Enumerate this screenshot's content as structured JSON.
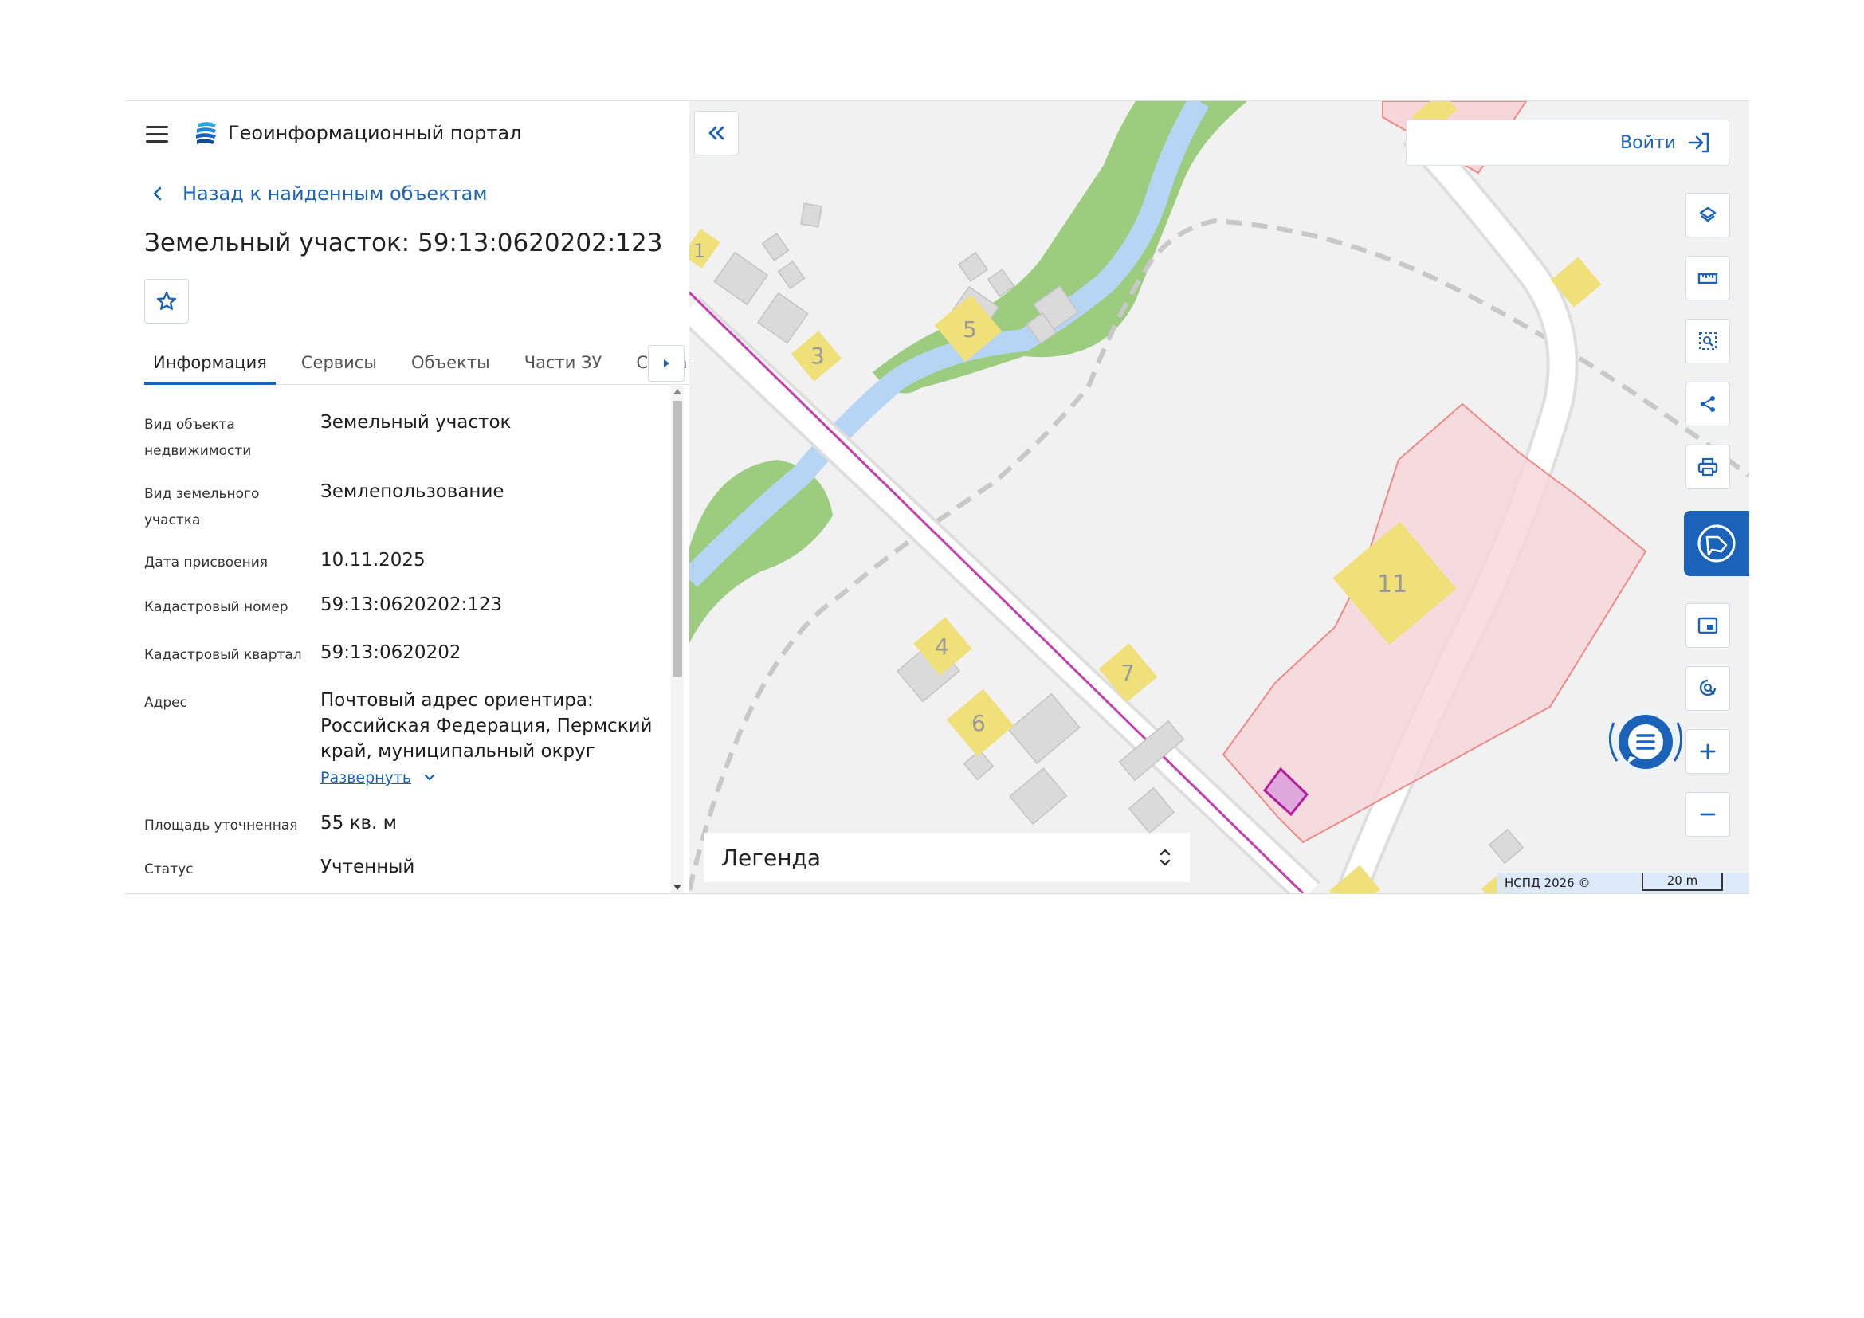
{
  "header": {
    "brand": "Геоинформационный портал"
  },
  "navigation": {
    "back_label": "Назад к найденным объектам"
  },
  "object": {
    "title": "Земельный участок: 59:13:0620202:123"
  },
  "tabs": [
    {
      "label": "Информация",
      "active": true
    },
    {
      "label": "Сервисы",
      "active": false
    },
    {
      "label": "Объекты",
      "active": false
    },
    {
      "label": "Части ЗУ",
      "active": false
    },
    {
      "label": "Состав",
      "active": false
    }
  ],
  "properties": {
    "object_type": {
      "label": "Вид объекта недвижимости",
      "value": "Земельный участок"
    },
    "land_type": {
      "label": "Вид земельного участка",
      "value": "Землепользование"
    },
    "assign_date": {
      "label": "Дата присвоения",
      "value": "10.11.2025"
    },
    "cadastral_number": {
      "label": "Кадастровый номер",
      "value": "59:13:0620202:123"
    },
    "cadastral_quarter": {
      "label": "Кадастровый квартал",
      "value": "59:13:0620202"
    },
    "address": {
      "label": "Адрес",
      "value": "Почтовый адрес ориентира: Российская Федерация, Пермский край, муниципальный округ",
      "expand_label": "Развернуть"
    },
    "area": {
      "label": "Площадь уточненная",
      "value": "55 кв. м"
    },
    "status": {
      "label": "Статус",
      "value": "Учтенный"
    }
  },
  "map": {
    "login_label": "Войти",
    "legend_label": "Легенда",
    "copyright": "НСПД 2026 ©",
    "scale_label": "20 m",
    "building_numbers": {
      "b1": "1",
      "b3": "3",
      "b4": "4",
      "b5": "5",
      "b6": "6",
      "b7": "7",
      "b11": "11"
    }
  },
  "colors": {
    "accent": "#1a63b8",
    "parcel_fill": "#f6d6d8",
    "parcel_stroke": "#ee8a86",
    "selected_parcel": "#c43fb0",
    "vegetation": "#9ccc7e",
    "water": "#b6d4f4",
    "building_yellow": "#efe07a"
  },
  "icons": {
    "menu": "hamburger-icon",
    "logo": "portal-logo-icon",
    "back": "chevron-left-icon",
    "favorite": "star-icon",
    "tabs_next": "caret-right-icon",
    "collapse": "double-chevron-left-icon",
    "login": "login-arrow-icon",
    "layers": "layers-icon",
    "ruler": "ruler-icon",
    "select_area": "select-area-icon",
    "share": "share-icon",
    "print": "printer-icon",
    "map_service": "map-service-icon",
    "minimap": "minimap-icon",
    "locate": "locate-icon",
    "zoom_in": "plus-icon",
    "zoom_out": "minus-icon",
    "chat": "chat-icon",
    "legend_toggle": "chevron-updown-icon"
  }
}
